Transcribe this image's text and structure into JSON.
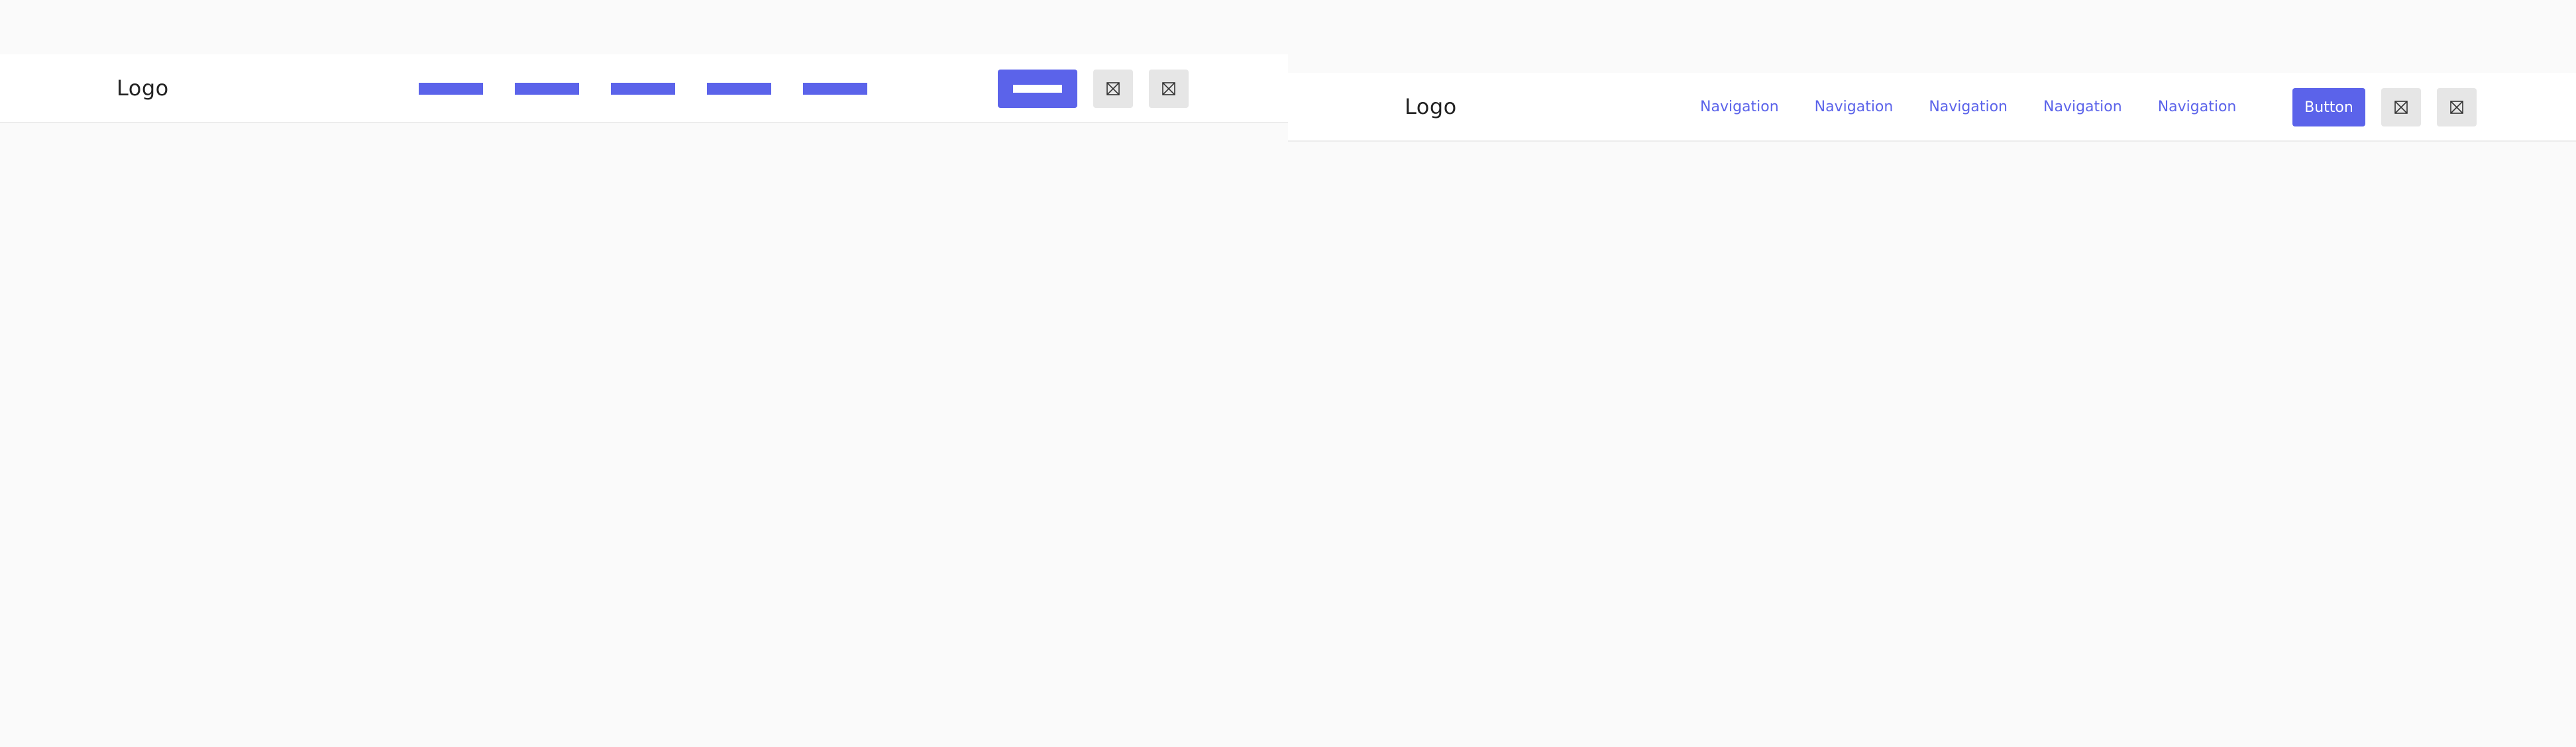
{
  "colors": {
    "accent": "#5b63ea",
    "background": "#fafafa",
    "navbar_background": "#ffffff",
    "icon_button_background": "#e6e6e6"
  },
  "wireframe_header": {
    "logo": "Logo",
    "nav_item_count": 5,
    "icons": [
      "image-placeholder-icon",
      "image-placeholder-icon"
    ]
  },
  "detailed_header": {
    "logo": "Logo",
    "nav_items": [
      "Navigation",
      "Navigation",
      "Navigation",
      "Navigation",
      "Navigation"
    ],
    "button_label": "Button",
    "icons": [
      "image-placeholder-icon",
      "image-placeholder-icon"
    ]
  }
}
